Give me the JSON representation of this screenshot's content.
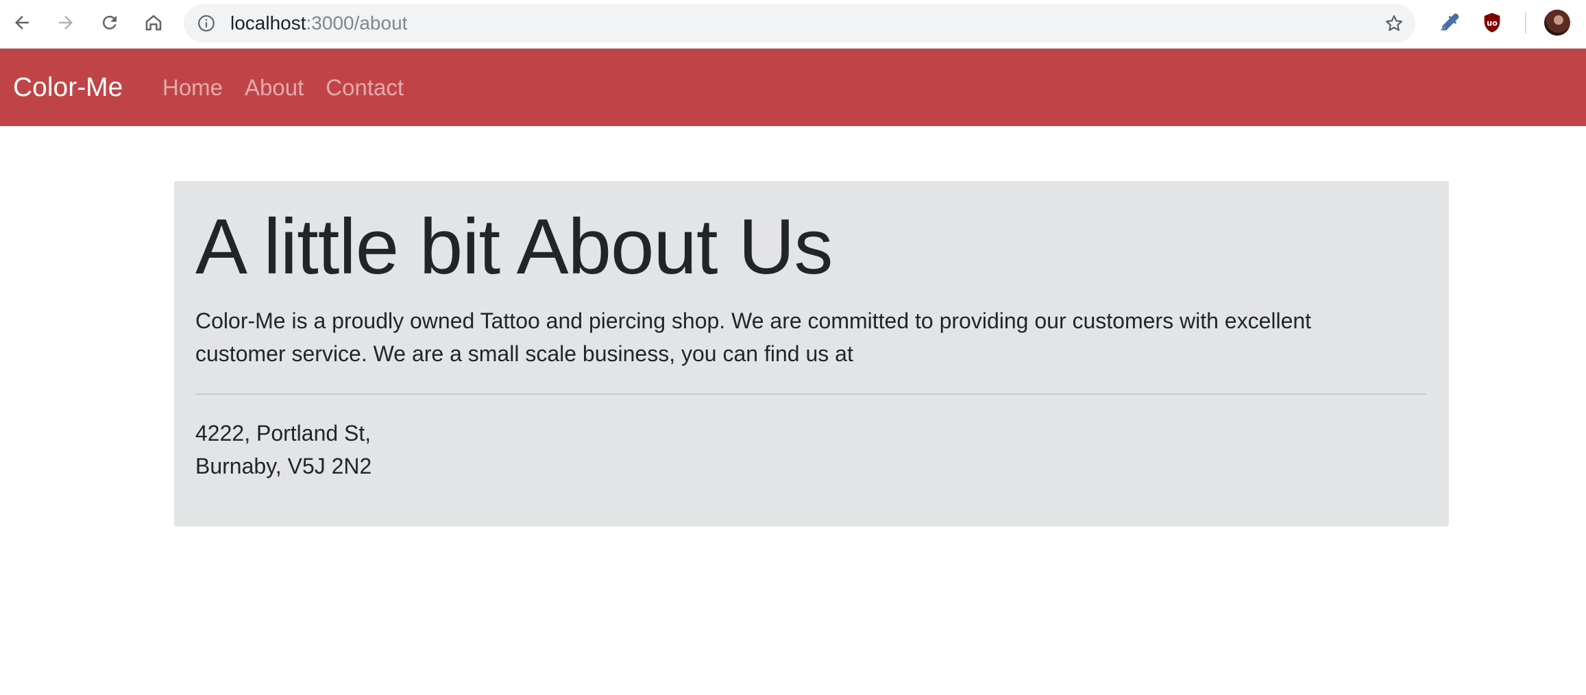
{
  "browser": {
    "url_host": "localhost",
    "url_path": ":3000/about",
    "icons": {
      "back": "back-arrow-icon",
      "forward": "forward-arrow-icon",
      "reload": "reload-icon",
      "home": "home-icon",
      "site_info": "info-icon",
      "bookmark": "star-icon",
      "eyedropper_extension": "eyedropper-icon",
      "ublock_extension": "shield-icon",
      "profile": "avatar"
    }
  },
  "navbar": {
    "brand": "Color-Me",
    "links": [
      {
        "label": "Home"
      },
      {
        "label": "About"
      },
      {
        "label": "Contact"
      }
    ],
    "background_color": "#c04447"
  },
  "jumbotron": {
    "title": "A little bit About Us",
    "lead_lines": [
      "Color-Me is a proudly owned Tattoo and piercing shop. We are committed to providing our customers with excellent",
      "customer service. We are a small scale business, you can find us at"
    ],
    "address_lines": [
      "4222, Portland St,",
      "Burnaby, V5J 2N2"
    ],
    "background_color": "#e3e4e6"
  }
}
